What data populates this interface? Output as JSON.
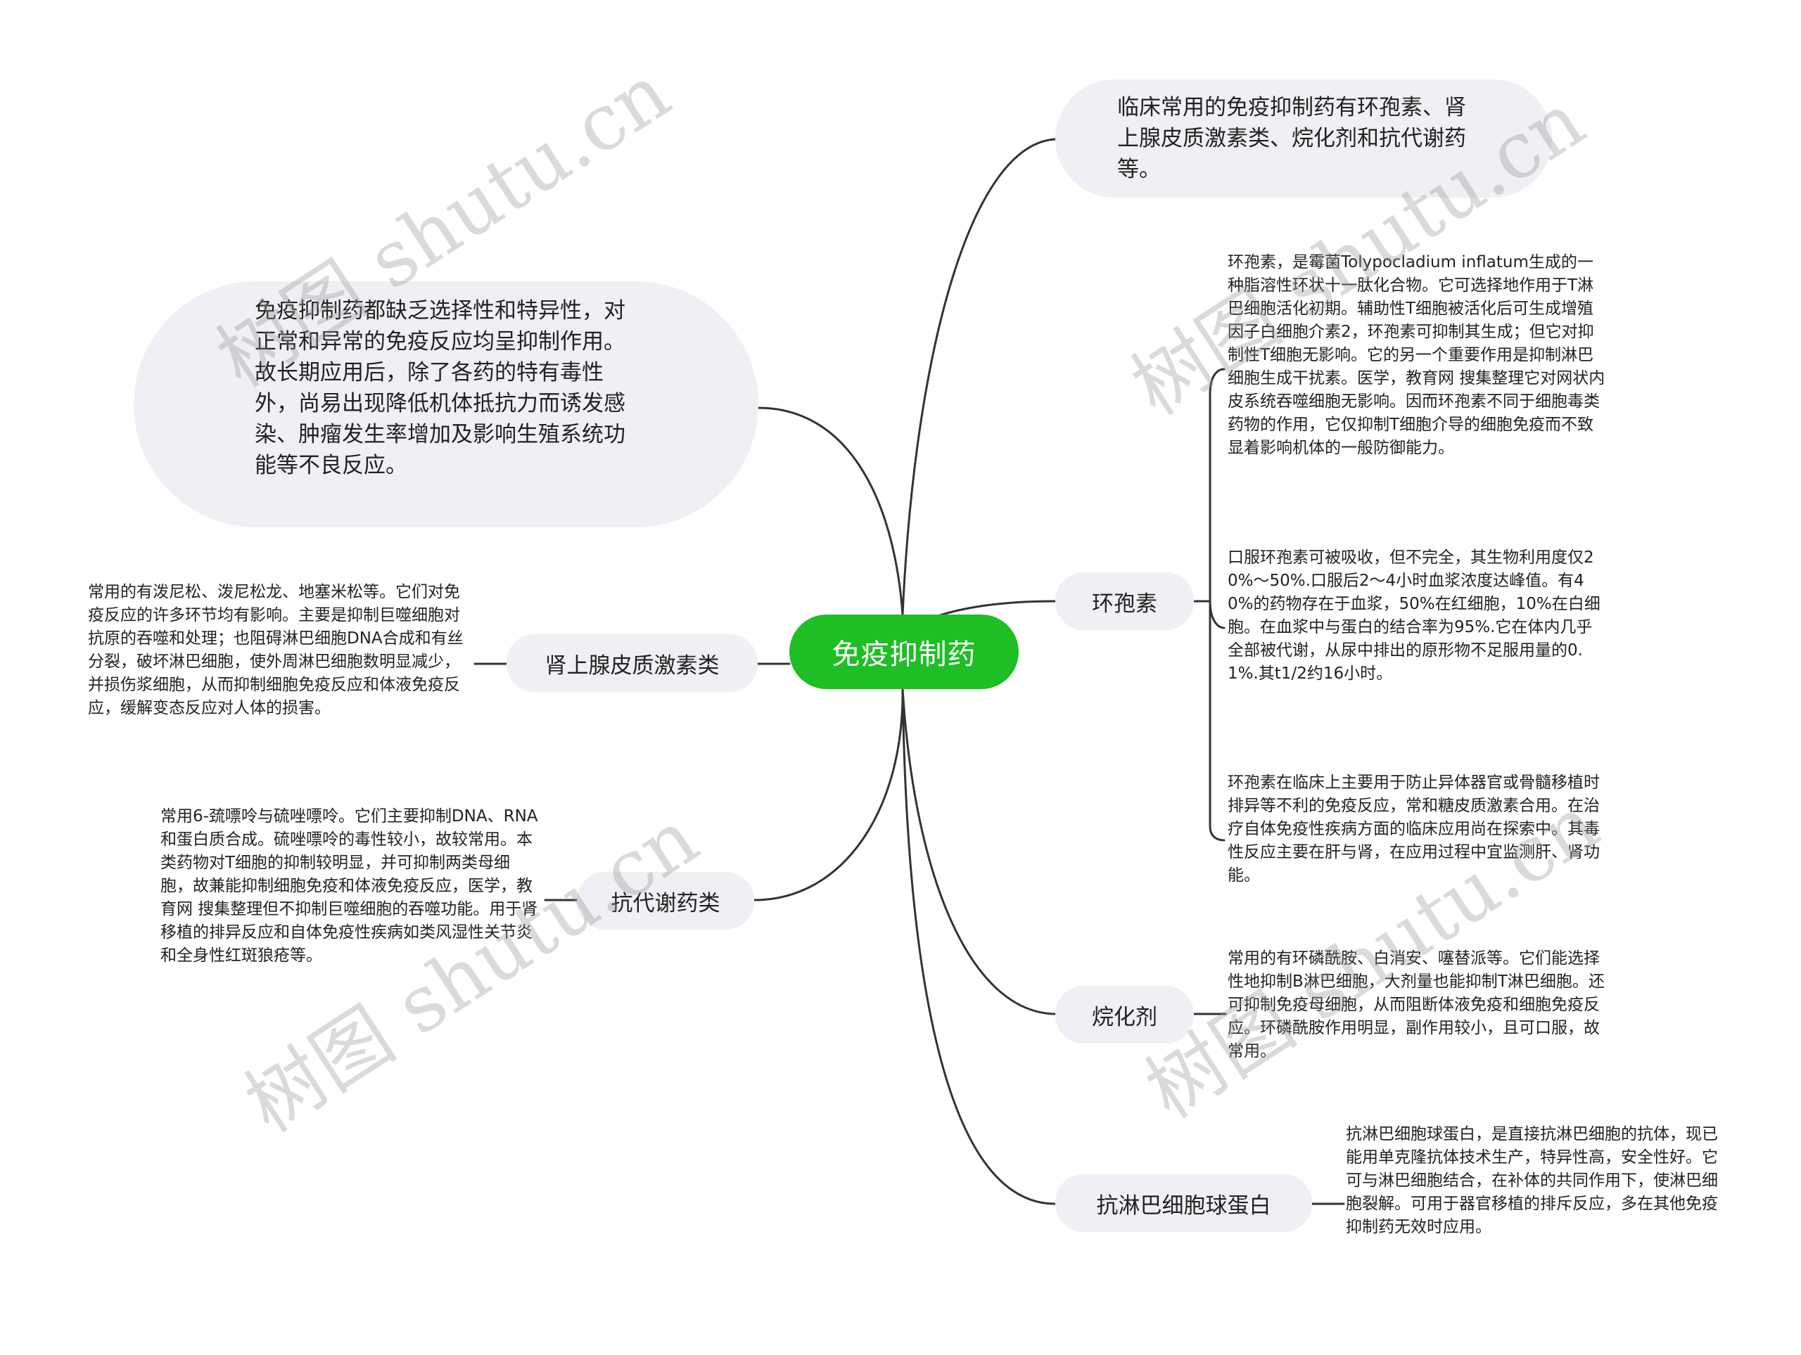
{
  "root": {
    "label": "免疫抑制药",
    "color": "#1dbf25"
  },
  "intro_top": "临床常用的免疫抑制药有环孢素、肾上腺皮质激素类、烷化剂和抗代谢药等。",
  "intro_left": "免疫抑制药都缺乏选择性和特异性，对正常和异常的免疫反应均呈抑制作用。故长期应用后，除了各药的特有毒性外，尚易出现降低机体抵抗力而诱发感染、肿瘤发生率增加及影响生殖系统功能等不良反应。",
  "branches": {
    "cyclosporine": {
      "label": "环孢素",
      "details": [
        "环孢素，是霉菌Tolypocladium inflatum生成的一种脂溶性环状十一肽化合物。它可选择地作用于T淋巴细胞活化初期。辅助性T细胞被活化后可生成增殖因子白细胞介素2，环孢素可抑制其生成；但它对抑制性T细胞无影响。它的另一个重要作用是抑制淋巴细胞生成干扰素。医学，教育网 搜集整理它对网状内皮系统吞噬细胞无影响。因而环孢素不同于细胞毒类药物的作用，它仅抑制T细胞介导的细胞免疫而不致显着影响机体的一般防御能力。",
        "口服环孢素可被吸收，但不完全，其生物利用度仅20%～50%.口服后2～4小时血浆浓度达峰值。有40%的药物存在于血浆，50%在红细胞，10%在白细胞。在血浆中与蛋白的结合率为95%.它在体内几乎全部被代谢，从尿中排出的原形物不足服用量的0.1%.其t1/2约16小时。",
        "环孢素在临床上主要用于防止异体器官或骨髓移植时排异等不利的免疫反应，常和糖皮质激素合用。在治疗自体免疫性疾病方面的临床应用尚在探索中。其毒性反应主要在肝与肾，在应用过程中宜监测肝、肾功能。"
      ]
    },
    "alkylating": {
      "label": "烷化剂",
      "detail": "常用的有环磷酰胺、白消安、噻替派等。它们能选择性地抑制B淋巴细胞，大剂量也能抑制T淋巴细胞。还可抑制免疫母细胞，从而阻断体液免疫和细胞免疫反应。环磷酰胺作用明显，副作用较小，且可口服，故常用。"
    },
    "antilymphocyte": {
      "label": "抗淋巴细胞球蛋白",
      "detail": "抗淋巴细胞球蛋白，是直接抗淋巴细胞的抗体，现已能用单克隆抗体技术生产，特异性高，安全性好。它可与淋巴细胞结合，在补体的共同作用下，使淋巴细胞裂解。可用于器官移植的排斥反应，多在其他免疫抑制药无效时应用。"
    },
    "corticosteroids": {
      "label": "肾上腺皮质激素类",
      "detail": "常用的有泼尼松、泼尼松龙、地塞米松等。它们对免疫反应的许多环节均有影响。主要是抑制巨噬细胞对抗原的吞噬和处理；也阻碍淋巴细胞DNA合成和有丝分裂，破坏淋巴细胞，使外周淋巴细胞数明显减少，并损伤浆细胞，从而抑制细胞免疫反应和体液免疫反应，缓解变态反应对人体的损害。"
    },
    "antimetabolites": {
      "label": "抗代谢药类",
      "detail": "常用6-巯嘌呤与硫唑嘌呤。它们主要抑制DNA、RNA和蛋白质合成。硫唑嘌呤的毒性较小，故较常用。本类药物对T细胞的抑制较明显，并可抑制两类母细胞，故兼能抑制细胞免疫和体液免疫反应，医学，教育网 搜集整理但不抑制巨噬细胞的吞噬功能。用于肾移植的排异反应和自体免疫性疾病如类风湿性关节炎和全身性红斑狼疮等。"
    }
  },
  "watermark": "树图 shutu.cn",
  "colors": {
    "line": "#333333",
    "bubble_bg": "#eef0f3"
  }
}
